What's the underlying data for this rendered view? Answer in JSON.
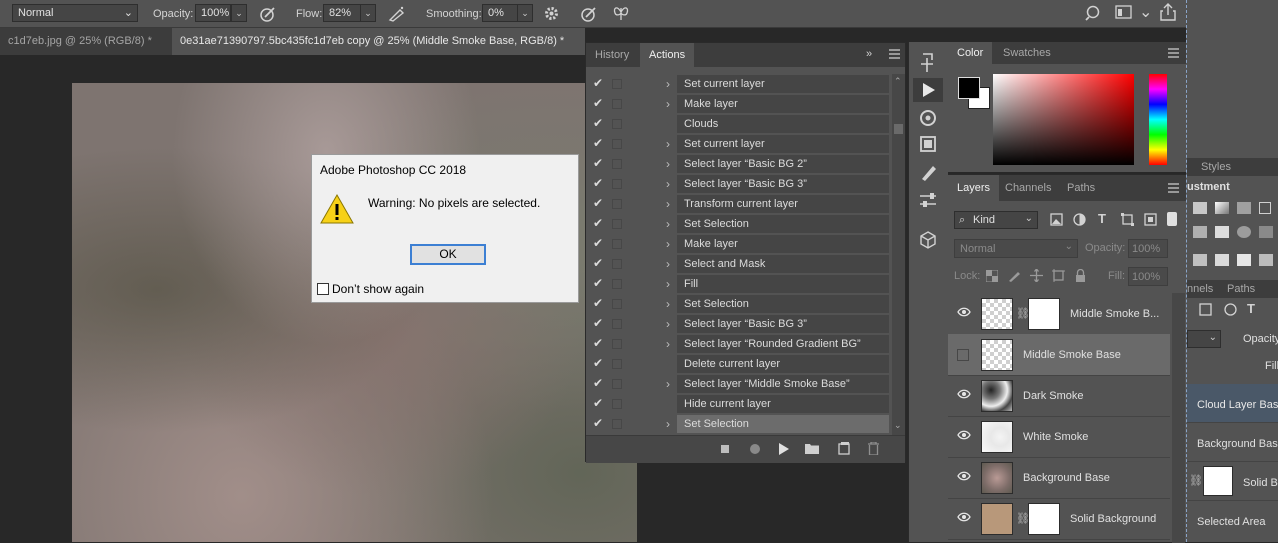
{
  "options_bar": {
    "mode": "Normal",
    "opacity_label": "Opacity:",
    "opacity_value": "100%",
    "flow_label": "Flow:",
    "flow_value": "82%",
    "smoothing_label": "Smoothing:",
    "smoothing_value": "0%"
  },
  "doc_tabs": [
    {
      "label": "c1d7eb.jpg @ 25% (RGB/8) *",
      "active": false
    },
    {
      "label": "0e31ae71390797.5bc435fc1d7eb copy @ 25% (Middle Smoke Base, RGB/8) *",
      "active": true
    }
  ],
  "dialog": {
    "title": "Adobe Photoshop CC 2018",
    "message": "Warning: No pixels are selected.",
    "ok_label": "OK",
    "dont_show_label": "Don’t show again"
  },
  "actions_panel": {
    "tabs": [
      "History",
      "Actions"
    ],
    "rows": [
      {
        "label": "Set current layer",
        "expandable": true
      },
      {
        "label": "Make layer",
        "expandable": true
      },
      {
        "label": "Clouds",
        "expandable": false
      },
      {
        "label": "Set current layer",
        "expandable": true
      },
      {
        "label": "Select layer “Basic BG 2”",
        "expandable": true
      },
      {
        "label": "Select layer “Basic BG 3”",
        "expandable": true
      },
      {
        "label": "Transform current layer",
        "expandable": true
      },
      {
        "label": "Set Selection",
        "expandable": true
      },
      {
        "label": "Make layer",
        "expandable": true
      },
      {
        "label": "Select and Mask",
        "expandable": true
      },
      {
        "label": "Fill",
        "expandable": true
      },
      {
        "label": "Set Selection",
        "expandable": true
      },
      {
        "label": "Select layer “Basic BG 3”",
        "expandable": true
      },
      {
        "label": "Select layer “Rounded Gradient BG”",
        "expandable": true
      },
      {
        "label": "Delete current layer",
        "expandable": false
      },
      {
        "label": "Select layer “Middle Smoke Base”",
        "expandable": true
      },
      {
        "label": "Hide current layer",
        "expandable": false
      },
      {
        "label": "Set Selection",
        "expandable": true,
        "selected": true
      }
    ]
  },
  "color_panel": {
    "tabs": [
      "Color",
      "Swatches"
    ],
    "foreground": "#000000",
    "background": "#ffffff"
  },
  "layers_panel": {
    "tabs": [
      "Layers",
      "Channels",
      "Paths"
    ],
    "filter_kind": "Kind",
    "blend_mode": "Normal",
    "opacity_label": "Opacity:",
    "opacity_value": "100%",
    "lock_label": "Lock:",
    "fill_label": "Fill:",
    "fill_value": "100%",
    "layers": [
      {
        "name": "Middle Smoke B...",
        "visible": true,
        "thumb": "checker",
        "has_mask": true
      },
      {
        "name": "Middle Smoke Base",
        "visible": false,
        "thumb": "checker",
        "has_mask": false,
        "selected": true
      },
      {
        "name": "Dark Smoke",
        "visible": true,
        "thumb": "dark-smoke",
        "has_mask": false
      },
      {
        "name": "White Smoke",
        "visible": true,
        "thumb": "white-smoke",
        "has_mask": false
      },
      {
        "name": "Background Base",
        "visible": true,
        "thumb": "photo",
        "has_mask": false
      },
      {
        "name": "Solid Background",
        "visible": true,
        "thumb": "solid",
        "has_mask": true
      }
    ]
  },
  "right_panel": {
    "styles_tab": "Styles",
    "adjustments_label": "ustment",
    "channels_tab": "nnels",
    "paths_tab": "Paths",
    "opacity_label": "Opacity:",
    "fill_label": "Fill:",
    "layers": [
      "Cloud Layer Base",
      "Background Base",
      "Solid Ba",
      "Selected Area"
    ]
  },
  "colors": {
    "ui_dark": "#282828",
    "panel": "#535353",
    "accent": "#3c7fd3",
    "warning": "#f7d117"
  }
}
